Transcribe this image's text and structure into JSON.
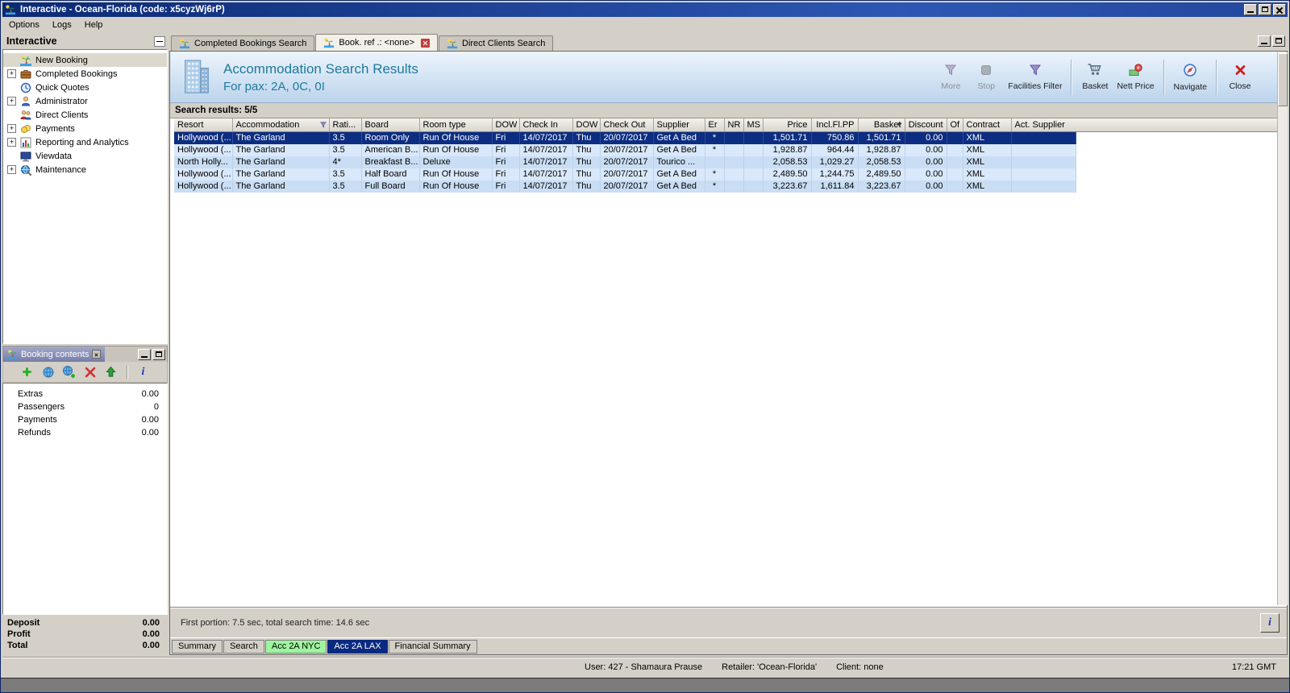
{
  "window": {
    "title": "Interactive - Ocean-Florida (code: x5cyzWj6rP)",
    "menu": {
      "options": "Options",
      "logs": "Logs",
      "help": "Help"
    }
  },
  "sidebar": {
    "title": "Interactive",
    "items": [
      {
        "label": "New Booking",
        "icon": "palm-icon",
        "expandable": false,
        "selected": true
      },
      {
        "label": "Completed Bookings",
        "icon": "suitcase-icon",
        "expandable": true,
        "selected": false
      },
      {
        "label": "Quick Quotes",
        "icon": "clock-icon",
        "expandable": false,
        "selected": false
      },
      {
        "label": "Administrator",
        "icon": "person-icon",
        "expandable": true,
        "selected": false
      },
      {
        "label": "Direct Clients",
        "icon": "people-icon",
        "expandable": false,
        "selected": false
      },
      {
        "label": "Payments",
        "icon": "coins-icon",
        "expandable": true,
        "selected": false
      },
      {
        "label": "Reporting and Analytics",
        "icon": "chart-icon",
        "expandable": true,
        "selected": false
      },
      {
        "label": "Viewdata",
        "icon": "monitor-icon",
        "expandable": false,
        "selected": false
      },
      {
        "label": "Maintenance",
        "icon": "gear-globe-icon",
        "expandable": true,
        "selected": false
      }
    ]
  },
  "booking_contents": {
    "title": "Booking contents",
    "toolbar_icons": [
      "add-icon",
      "globe-icon",
      "globe-add-icon",
      "delete-icon",
      "up-arrow-icon",
      "info-icon"
    ],
    "rows": [
      {
        "label": "Extras",
        "value": "0.00"
      },
      {
        "label": "Passengers",
        "value": "0"
      },
      {
        "label": "Payments",
        "value": "0.00"
      },
      {
        "label": "Refunds",
        "value": "0.00"
      }
    ],
    "totals": [
      {
        "label": "Deposit",
        "value": "0.00"
      },
      {
        "label": "Profit",
        "value": "0.00"
      },
      {
        "label": "Total",
        "value": "0.00"
      }
    ]
  },
  "tabs": [
    {
      "label": "Completed Bookings Search",
      "active": false
    },
    {
      "label": "Book. ref .: <none>",
      "active": true,
      "closable": true
    },
    {
      "label": "Direct Clients Search",
      "active": false
    }
  ],
  "header": {
    "title": "Accommodation Search Results",
    "subtitle": "For pax: 2A, 0C, 0I",
    "toolbar": {
      "more": {
        "label": "More",
        "disabled": true
      },
      "stop": {
        "label": "Stop",
        "disabled": true
      },
      "facilities_filter": {
        "label": "Facilities Filter",
        "disabled": false
      },
      "basket": {
        "label": "Basket",
        "disabled": false
      },
      "nett_price": {
        "label": "Nett Price",
        "disabled": false
      },
      "navigate": {
        "label": "Navigate",
        "disabled": false
      },
      "close": {
        "label": "Close",
        "disabled": false
      }
    }
  },
  "results": {
    "summary": "Search results: 5/5",
    "columns": [
      "Resort",
      "Accommodation",
      "Rati...",
      "Board",
      "Room type",
      "DOW",
      "Check In",
      "DOW",
      "Check Out",
      "Supplier",
      "Er",
      "NR",
      "MS",
      "Price",
      "Incl.Fl.PP",
      "Basket",
      "Discount",
      "Of",
      "Contract",
      "Act. Supplier"
    ],
    "rows": [
      {
        "selected": true,
        "cells": [
          "Hollywood (...",
          "The Garland",
          "3.5",
          "Room Only",
          "Run Of House",
          "Fri",
          "14/07/2017",
          "Thu",
          "20/07/2017",
          "Get A Bed",
          "*",
          "",
          "",
          "1,501.71",
          "750.86",
          "1,501.71",
          "0.00",
          "",
          "XML",
          ""
        ]
      },
      {
        "selected": false,
        "cells": [
          "Hollywood (...",
          "The Garland",
          "3.5",
          "American B...",
          "Run Of House",
          "Fri",
          "14/07/2017",
          "Thu",
          "20/07/2017",
          "Get A Bed",
          "*",
          "",
          "",
          "1,928.87",
          "964.44",
          "1,928.87",
          "0.00",
          "",
          "XML",
          ""
        ]
      },
      {
        "selected": false,
        "cells": [
          "North Holly...",
          "The Garland",
          "4*",
          "Breakfast B...",
          "Deluxe",
          "Fri",
          "14/07/2017",
          "Thu",
          "20/07/2017",
          "Tourico ...",
          "",
          "",
          "",
          "2,058.53",
          "1,029.27",
          "2,058.53",
          "0.00",
          "",
          "XML",
          ""
        ]
      },
      {
        "selected": false,
        "cells": [
          "Hollywood (...",
          "The Garland",
          "3.5",
          "Half Board",
          "Run Of House",
          "Fri",
          "14/07/2017",
          "Thu",
          "20/07/2017",
          "Get A Bed",
          "*",
          "",
          "",
          "2,489.50",
          "1,244.75",
          "2,489.50",
          "0.00",
          "",
          "XML",
          ""
        ]
      },
      {
        "selected": false,
        "cells": [
          "Hollywood (...",
          "The Garland",
          "3.5",
          "Full Board",
          "Run Of House",
          "Fri",
          "14/07/2017",
          "Thu",
          "20/07/2017",
          "Get A Bed",
          "*",
          "",
          "",
          "3,223.67",
          "1,611.84",
          "3,223.67",
          "0.00",
          "",
          "XML",
          ""
        ]
      }
    ]
  },
  "status_line": {
    "text": "First portion: 7.5 sec, total search time: 14.6 sec"
  },
  "bottom_tabs": [
    {
      "label": "Summary",
      "highlight": "none",
      "active": false
    },
    {
      "label": "Search",
      "highlight": "none",
      "active": false
    },
    {
      "label": "Acc 2A NYC",
      "highlight": "green",
      "active": false
    },
    {
      "label": "Acc 2A LAX",
      "highlight": "blue",
      "active": true
    },
    {
      "label": "Financial Summary",
      "highlight": "none",
      "active": false
    }
  ],
  "statusbar": {
    "user": "User: 427 - Shamaura Prause",
    "retailer": "Retailer: 'Ocean-Florida'",
    "client": "Client: none",
    "time": "17:21 GMT"
  },
  "icons": {
    "info_glyph": "i"
  },
  "colors": {
    "selection_row": "#0c2d81",
    "row_light": "#c9def4",
    "row_alt": "#d9e8fa",
    "header_title_text": "#1f7a9c",
    "tab_green": "#9df59d",
    "tab_blue": "#0a2a80"
  }
}
